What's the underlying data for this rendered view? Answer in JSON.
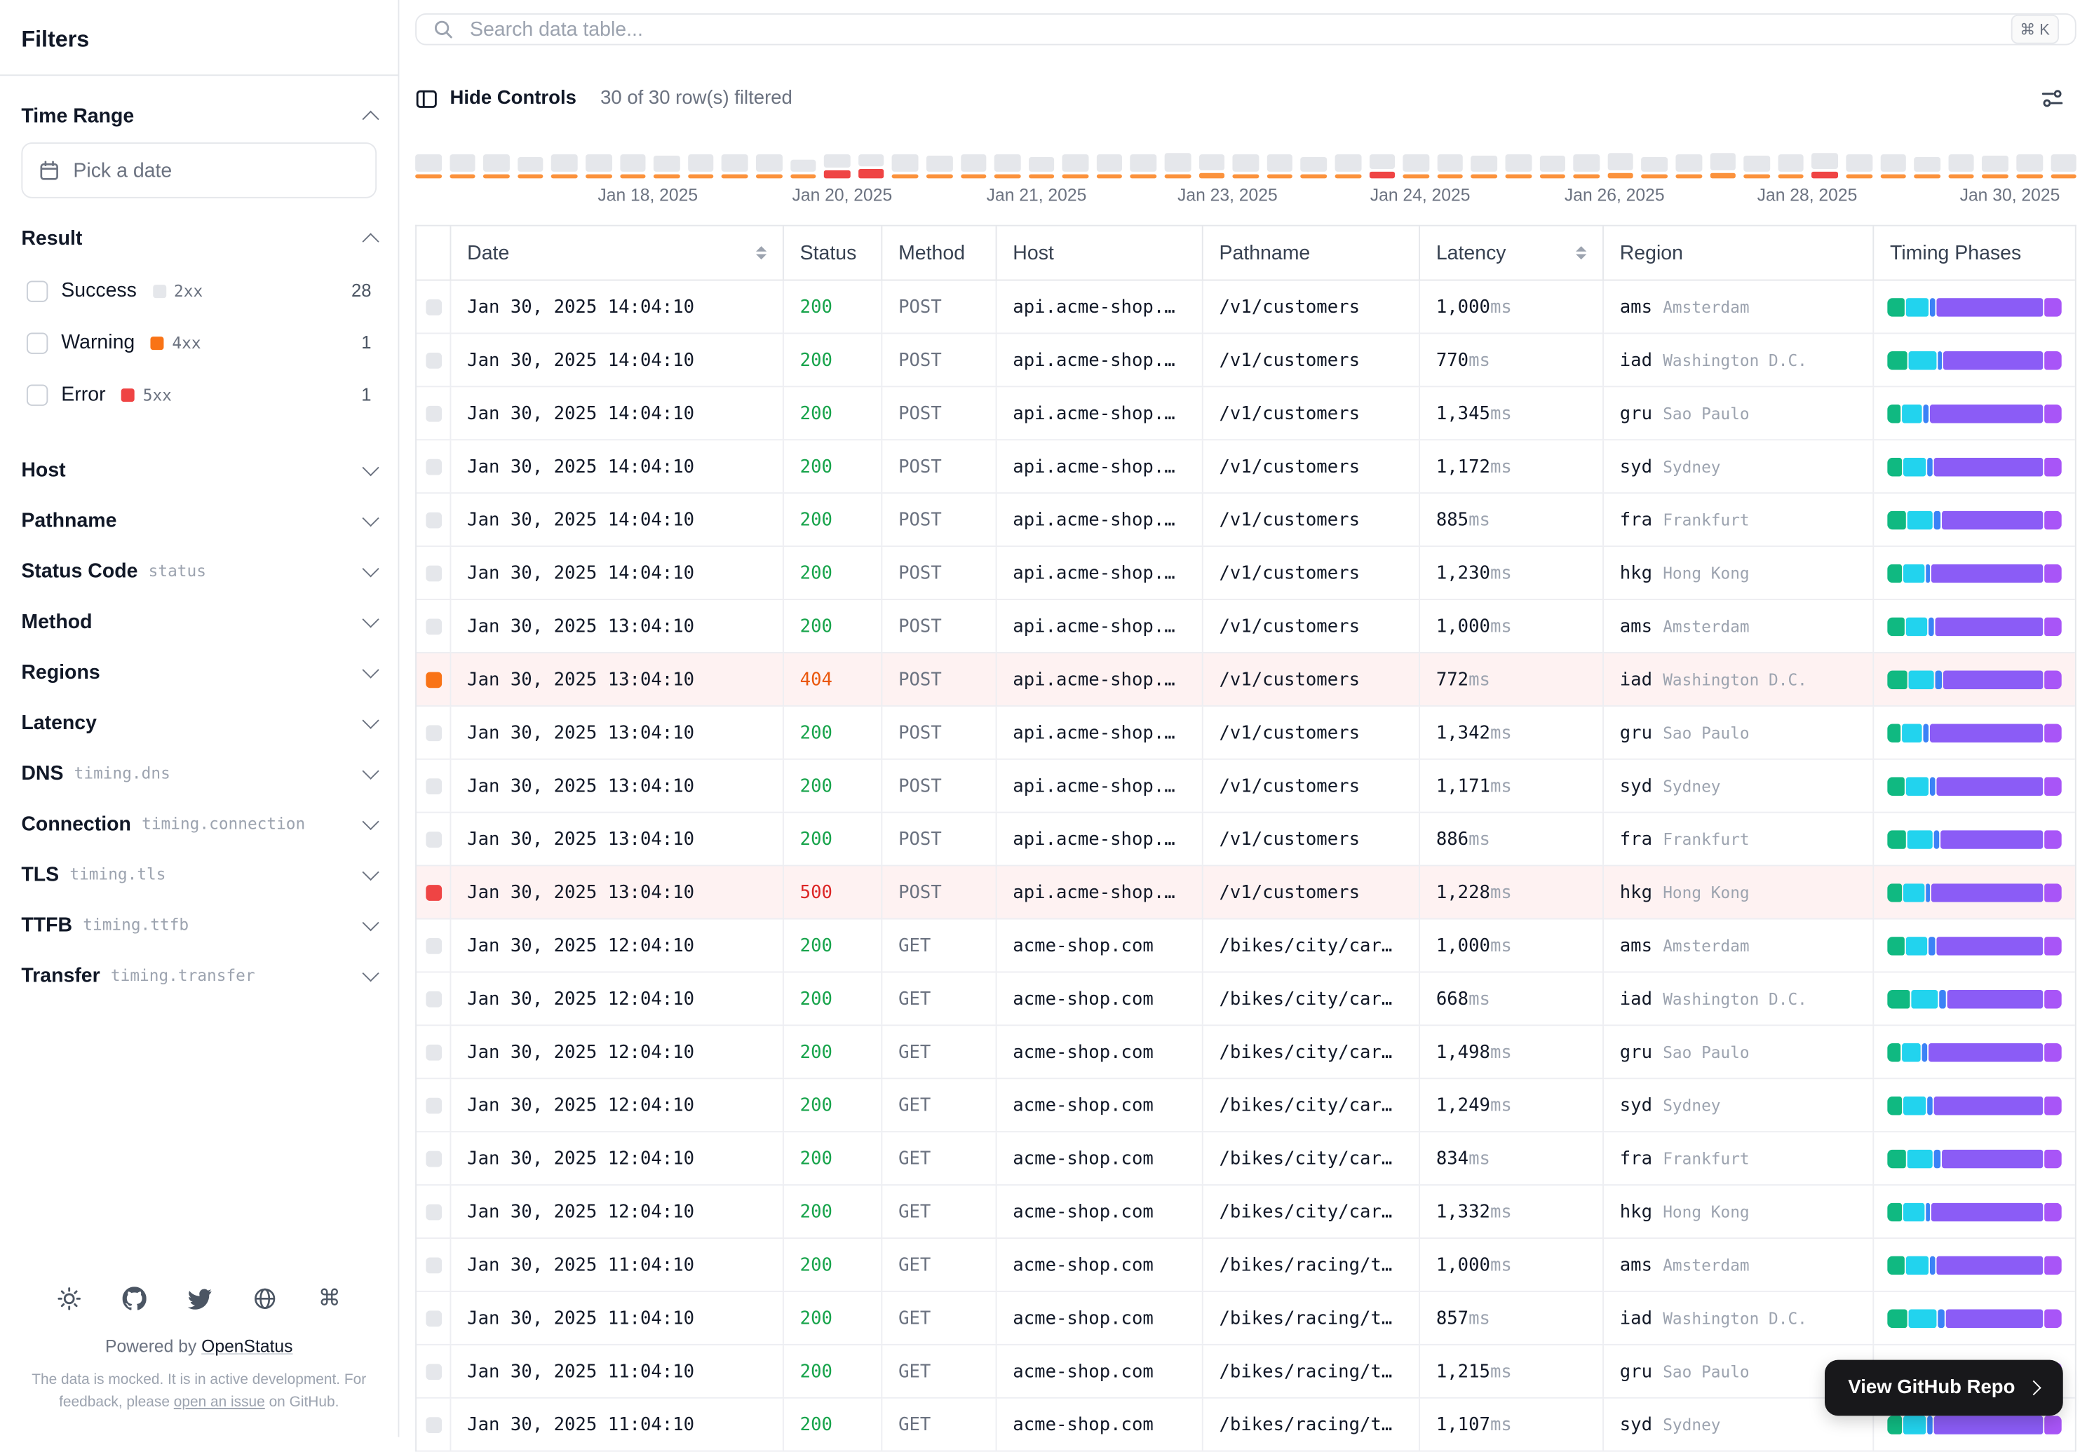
{
  "sidebar": {
    "title": "Filters",
    "time_range": {
      "label": "Time Range",
      "picker_placeholder": "Pick a date"
    },
    "result": {
      "label": "Result",
      "options": [
        {
          "label": "Success",
          "badge": "2xx",
          "count": "28",
          "color": "#e5e7eb"
        },
        {
          "label": "Warning",
          "badge": "4xx",
          "count": "1",
          "color": "#f97316"
        },
        {
          "label": "Error",
          "badge": "5xx",
          "count": "1",
          "color": "#ef4444"
        }
      ]
    },
    "collapsed_sections": [
      {
        "label": "Host",
        "sub": ""
      },
      {
        "label": "Pathname",
        "sub": ""
      },
      {
        "label": "Status Code",
        "sub": "status"
      },
      {
        "label": "Method",
        "sub": ""
      },
      {
        "label": "Regions",
        "sub": ""
      },
      {
        "label": "Latency",
        "sub": ""
      },
      {
        "label": "DNS",
        "sub": "timing.dns"
      },
      {
        "label": "Connection",
        "sub": "timing.connection"
      },
      {
        "label": "TLS",
        "sub": "timing.tls"
      },
      {
        "label": "TTFB",
        "sub": "timing.ttfb"
      },
      {
        "label": "Transfer",
        "sub": "timing.transfer"
      }
    ],
    "footer": {
      "powered_by": "Powered by",
      "brand": "OpenStatus",
      "note_p1": "The data is mocked. It is in active development. For feedback, please ",
      "note_link": "open an issue",
      "note_p2": " on GitHub."
    }
  },
  "search": {
    "placeholder": "Search data table...",
    "shortcut": "⌘ K"
  },
  "toolbar": {
    "hide_controls": "Hide Controls",
    "filtered": "30 of 30 row(s) filtered"
  },
  "colors": {
    "success_text": "#16a34a",
    "warning_text": "#ea580c",
    "error_text": "#dc2626",
    "success_indicator": "#e5e7eb",
    "warning_indicator": "#f97316",
    "error_indicator": "#ef4444",
    "row_highlight": "#fef2f2",
    "chart_gray": "#e5e7eb",
    "chart_orange": "#fb923c",
    "chart_red": "#ef4444",
    "timing": [
      "#10b981",
      "#22d3ee",
      "#3b82f6",
      "#8b5cf6",
      "#a855f7"
    ]
  },
  "chart_data": {
    "type": "bar",
    "x_labels": [
      {
        "label": "Jan 18, 2025",
        "pos": 14
      },
      {
        "label": "Jan 20, 2025",
        "pos": 25.7
      },
      {
        "label": "Jan 21, 2025",
        "pos": 37.4
      },
      {
        "label": "Jan 23, 2025",
        "pos": 48.9
      },
      {
        "label": "Jan 24, 2025",
        "pos": 60.5
      },
      {
        "label": "Jan 26, 2025",
        "pos": 72.2
      },
      {
        "label": "Jan 28, 2025",
        "pos": 83.8
      },
      {
        "label": "Jan 30, 2025",
        "pos": 96
      }
    ],
    "bars": [
      {
        "g": 13,
        "c": "o",
        "ah": 3
      },
      {
        "g": 13,
        "c": "o",
        "ah": 3
      },
      {
        "g": 13,
        "c": "o",
        "ah": 3
      },
      {
        "g": 11,
        "c": "o",
        "ah": 3
      },
      {
        "g": 13,
        "c": "o",
        "ah": 3
      },
      {
        "g": 13,
        "c": "o",
        "ah": 3
      },
      {
        "g": 13,
        "c": "o",
        "ah": 3
      },
      {
        "g": 12,
        "c": "o",
        "ah": 3
      },
      {
        "g": 13,
        "c": "o",
        "ah": 3
      },
      {
        "g": 13,
        "c": "o",
        "ah": 3
      },
      {
        "g": 13,
        "c": "o",
        "ah": 3
      },
      {
        "g": 9,
        "c": "o",
        "ah": 3
      },
      {
        "g": 10,
        "c": "r",
        "ah": 6
      },
      {
        "g": 9,
        "c": "r",
        "ah": 7
      },
      {
        "g": 13,
        "c": "o",
        "ah": 3
      },
      {
        "g": 12,
        "c": "o",
        "ah": 3
      },
      {
        "g": 13,
        "c": "o",
        "ah": 3
      },
      {
        "g": 13,
        "c": "o",
        "ah": 3
      },
      {
        "g": 11,
        "c": "o",
        "ah": 3
      },
      {
        "g": 13,
        "c": "o",
        "ah": 3
      },
      {
        "g": 13,
        "c": "o",
        "ah": 3
      },
      {
        "g": 13,
        "c": "o",
        "ah": 3
      },
      {
        "g": 14,
        "c": "o",
        "ah": 3
      },
      {
        "g": 12,
        "c": "o",
        "ah": 4
      },
      {
        "g": 13,
        "c": "o",
        "ah": 3
      },
      {
        "g": 13,
        "c": "o",
        "ah": 3
      },
      {
        "g": 11,
        "c": "o",
        "ah": 3
      },
      {
        "g": 13,
        "c": "o",
        "ah": 3
      },
      {
        "g": 11,
        "c": "r",
        "ah": 5
      },
      {
        "g": 13,
        "c": "o",
        "ah": 3
      },
      {
        "g": 13,
        "c": "o",
        "ah": 3
      },
      {
        "g": 12,
        "c": "o",
        "ah": 3
      },
      {
        "g": 13,
        "c": "o",
        "ah": 3
      },
      {
        "g": 12,
        "c": "o",
        "ah": 3
      },
      {
        "g": 13,
        "c": "o",
        "ah": 3
      },
      {
        "g": 13,
        "c": "o",
        "ah": 4
      },
      {
        "g": 11,
        "c": "o",
        "ah": 3
      },
      {
        "g": 13,
        "c": "o",
        "ah": 3
      },
      {
        "g": 13,
        "c": "o",
        "ah": 4
      },
      {
        "g": 12,
        "c": "o",
        "ah": 3
      },
      {
        "g": 13,
        "c": "o",
        "ah": 3
      },
      {
        "g": 12,
        "c": "r",
        "ah": 5
      },
      {
        "g": 13,
        "c": "o",
        "ah": 3
      },
      {
        "g": 13,
        "c": "o",
        "ah": 3
      },
      {
        "g": 11,
        "c": "o",
        "ah": 3
      },
      {
        "g": 13,
        "c": "o",
        "ah": 3
      },
      {
        "g": 12,
        "c": "o",
        "ah": 3
      },
      {
        "g": 13,
        "c": "o",
        "ah": 3
      },
      {
        "g": 13,
        "c": "o",
        "ah": 3
      }
    ]
  },
  "table": {
    "columns": [
      {
        "label": "Date",
        "sortable": true
      },
      {
        "label": "Status",
        "sortable": false
      },
      {
        "label": "Method",
        "sortable": false
      },
      {
        "label": "Host",
        "sortable": false
      },
      {
        "label": "Pathname",
        "sortable": false
      },
      {
        "label": "Latency",
        "sortable": true
      },
      {
        "label": "Region",
        "sortable": false
      },
      {
        "label": "Timing Phases",
        "sortable": false
      }
    ],
    "rows": [
      {
        "date": "Jan 30, 2025 14:04:10",
        "status": "200",
        "type": "success",
        "method": "POST",
        "host": "api.acme-shop.…",
        "pathname": "/v1/customers",
        "latency": "1,000",
        "unit": "ms",
        "region_code": "ams",
        "region_city": "Amsterdam",
        "timing": [
          10,
          14,
          3,
          63,
          10
        ]
      },
      {
        "date": "Jan 30, 2025 14:04:10",
        "status": "200",
        "type": "success",
        "method": "POST",
        "host": "api.acme-shop.…",
        "pathname": "/v1/customers",
        "latency": "770",
        "unit": "ms",
        "region_code": "iad",
        "region_city": "Washington D.C.",
        "timing": [
          12,
          16,
          3,
          59,
          10
        ]
      },
      {
        "date": "Jan 30, 2025 14:04:10",
        "status": "200",
        "type": "success",
        "method": "POST",
        "host": "api.acme-shop.…",
        "pathname": "/v1/customers",
        "latency": "1,345",
        "unit": "ms",
        "region_code": "gru",
        "region_city": "Sao Paulo",
        "timing": [
          8,
          12,
          3,
          67,
          10
        ]
      },
      {
        "date": "Jan 30, 2025 14:04:10",
        "status": "200",
        "type": "success",
        "method": "POST",
        "host": "api.acme-shop.…",
        "pathname": "/v1/customers",
        "latency": "1,172",
        "unit": "ms",
        "region_code": "syd",
        "region_city": "Sydney",
        "timing": [
          9,
          13,
          3,
          65,
          10
        ]
      },
      {
        "date": "Jan 30, 2025 14:04:10",
        "status": "200",
        "type": "success",
        "method": "POST",
        "host": "api.acme-shop.…",
        "pathname": "/v1/customers",
        "latency": "885",
        "unit": "ms",
        "region_code": "fra",
        "region_city": "Frankfurt",
        "timing": [
          11,
          15,
          4,
          60,
          10
        ]
      },
      {
        "date": "Jan 30, 2025 14:04:10",
        "status": "200",
        "type": "success",
        "method": "POST",
        "host": "api.acme-shop.…",
        "pathname": "/v1/customers",
        "latency": "1,230",
        "unit": "ms",
        "region_code": "hkg",
        "region_city": "Hong Kong",
        "timing": [
          9,
          12,
          3,
          66,
          10
        ]
      },
      {
        "date": "Jan 30, 2025 13:04:10",
        "status": "200",
        "type": "success",
        "method": "POST",
        "host": "api.acme-shop.…",
        "pathname": "/v1/customers",
        "latency": "1,000",
        "unit": "ms",
        "region_code": "ams",
        "region_city": "Amsterdam",
        "timing": [
          10,
          13,
          3,
          64,
          10
        ]
      },
      {
        "date": "Jan 30, 2025 13:04:10",
        "status": "404",
        "type": "warning",
        "method": "POST",
        "host": "api.acme-shop.…",
        "pathname": "/v1/customers",
        "latency": "772",
        "unit": "ms",
        "region_code": "iad",
        "region_city": "Washington D.C.",
        "timing": [
          12,
          15,
          4,
          59,
          10
        ]
      },
      {
        "date": "Jan 30, 2025 13:04:10",
        "status": "200",
        "type": "success",
        "method": "POST",
        "host": "api.acme-shop.…",
        "pathname": "/v1/customers",
        "latency": "1,342",
        "unit": "ms",
        "region_code": "gru",
        "region_city": "Sao Paulo",
        "timing": [
          8,
          12,
          3,
          67,
          10
        ]
      },
      {
        "date": "Jan 30, 2025 13:04:10",
        "status": "200",
        "type": "success",
        "method": "POST",
        "host": "api.acme-shop.…",
        "pathname": "/v1/customers",
        "latency": "1,171",
        "unit": "ms",
        "region_code": "syd",
        "region_city": "Sydney",
        "timing": [
          10,
          14,
          3,
          63,
          10
        ]
      },
      {
        "date": "Jan 30, 2025 13:04:10",
        "status": "200",
        "type": "success",
        "method": "POST",
        "host": "api.acme-shop.…",
        "pathname": "/v1/customers",
        "latency": "886",
        "unit": "ms",
        "region_code": "fra",
        "region_city": "Frankfurt",
        "timing": [
          11,
          15,
          3,
          61,
          10
        ]
      },
      {
        "date": "Jan 30, 2025 13:04:10",
        "status": "500",
        "type": "error",
        "method": "POST",
        "host": "api.acme-shop.…",
        "pathname": "/v1/customers",
        "latency": "1,228",
        "unit": "ms",
        "region_code": "hkg",
        "region_city": "Hong Kong",
        "timing": [
          9,
          12,
          3,
          66,
          10
        ]
      },
      {
        "date": "Jan 30, 2025 12:04:10",
        "status": "200",
        "type": "success",
        "method": "GET",
        "host": "acme-shop.com",
        "pathname": "/bikes/city/car…",
        "latency": "1,000",
        "unit": "ms",
        "region_code": "ams",
        "region_city": "Amsterdam",
        "timing": [
          10,
          13,
          4,
          63,
          10
        ]
      },
      {
        "date": "Jan 30, 2025 12:04:10",
        "status": "200",
        "type": "success",
        "method": "GET",
        "host": "acme-shop.com",
        "pathname": "/bikes/city/car…",
        "latency": "668",
        "unit": "ms",
        "region_code": "iad",
        "region_city": "Washington D.C.",
        "timing": [
          13,
          16,
          4,
          57,
          10
        ]
      },
      {
        "date": "Jan 30, 2025 12:04:10",
        "status": "200",
        "type": "success",
        "method": "GET",
        "host": "acme-shop.com",
        "pathname": "/bikes/city/car…",
        "latency": "1,498",
        "unit": "ms",
        "region_code": "gru",
        "region_city": "Sao Paulo",
        "timing": [
          8,
          11,
          3,
          68,
          10
        ]
      },
      {
        "date": "Jan 30, 2025 12:04:10",
        "status": "200",
        "type": "success",
        "method": "GET",
        "host": "acme-shop.com",
        "pathname": "/bikes/city/car…",
        "latency": "1,249",
        "unit": "ms",
        "region_code": "syd",
        "region_city": "Sydney",
        "timing": [
          9,
          13,
          3,
          65,
          10
        ]
      },
      {
        "date": "Jan 30, 2025 12:04:10",
        "status": "200",
        "type": "success",
        "method": "GET",
        "host": "acme-shop.com",
        "pathname": "/bikes/city/car…",
        "latency": "834",
        "unit": "ms",
        "region_code": "fra",
        "region_city": "Frankfurt",
        "timing": [
          11,
          15,
          4,
          60,
          10
        ]
      },
      {
        "date": "Jan 30, 2025 12:04:10",
        "status": "200",
        "type": "success",
        "method": "GET",
        "host": "acme-shop.com",
        "pathname": "/bikes/city/car…",
        "latency": "1,332",
        "unit": "ms",
        "region_code": "hkg",
        "region_city": "Hong Kong",
        "timing": [
          9,
          12,
          3,
          66,
          10
        ]
      },
      {
        "date": "Jan 30, 2025 11:04:10",
        "status": "200",
        "type": "success",
        "method": "GET",
        "host": "acme-shop.com",
        "pathname": "/bikes/racing/t…",
        "latency": "1,000",
        "unit": "ms",
        "region_code": "ams",
        "region_city": "Amsterdam",
        "timing": [
          10,
          14,
          3,
          63,
          10
        ]
      },
      {
        "date": "Jan 30, 2025 11:04:10",
        "status": "200",
        "type": "success",
        "method": "GET",
        "host": "acme-shop.com",
        "pathname": "/bikes/racing/t…",
        "latency": "857",
        "unit": "ms",
        "region_code": "iad",
        "region_city": "Washington D.C.",
        "timing": [
          12,
          16,
          4,
          58,
          10
        ]
      },
      {
        "date": "Jan 30, 2025 11:04:10",
        "status": "200",
        "type": "success",
        "method": "GET",
        "host": "acme-shop.com",
        "pathname": "/bikes/racing/t…",
        "latency": "1,215",
        "unit": "ms",
        "region_code": "gru",
        "region_city": "Sao Paulo",
        "timing": [
          8,
          12,
          3,
          67,
          10
        ]
      },
      {
        "date": "Jan 30, 2025 11:04:10",
        "status": "200",
        "type": "success",
        "method": "GET",
        "host": "acme-shop.com",
        "pathname": "/bikes/racing/t…",
        "latency": "1,107",
        "unit": "ms",
        "region_code": "syd",
        "region_city": "Sydney",
        "timing": [
          9,
          13,
          3,
          65,
          10
        ]
      }
    ]
  },
  "github_button": {
    "label": "View GitHub Repo"
  }
}
